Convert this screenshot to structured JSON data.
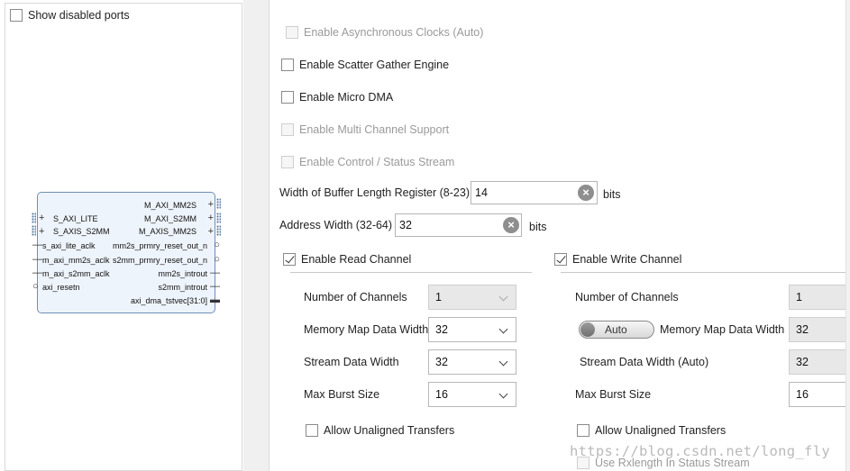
{
  "left": {
    "show_disabled_ports": "Show disabled ports",
    "ip": {
      "left_ports": [
        "S_AXI_LITE",
        "S_AXIS_S2MM",
        "s_axi_lite_aclk",
        "m_axi_mm2s_aclk",
        "m_axi_s2mm_aclk",
        "axi_resetn"
      ],
      "right_ports": [
        "M_AXI_MM2S",
        "M_AXI_S2MM",
        "M_AXIS_MM2S",
        "mm2s_prmry_reset_out_n",
        "s2mm_prmry_reset_out_n",
        "mm2s_introut",
        "s2mm_introut",
        "axi_dma_tstvec[31:0]"
      ]
    }
  },
  "options": {
    "async_clocks": "Enable Asynchronous Clocks (Auto)",
    "scatter_gather": "Enable Scatter Gather Engine",
    "micro_dma": "Enable Micro DMA",
    "multi_channel": "Enable Multi Channel Support",
    "control_status": "Enable Control / Status Stream"
  },
  "buffer_length": {
    "label": "Width of Buffer Length Register (8-23)",
    "value": "14",
    "unit": "bits"
  },
  "address_width": {
    "label": "Address Width (32-64)",
    "value": "32",
    "unit": "bits"
  },
  "read": {
    "enable_label": "Enable Read Channel",
    "num_channels_label": "Number of Channels",
    "num_channels": "1",
    "mm_width_label": "Memory Map Data Width",
    "mm_width": "32",
    "stream_width_label": "Stream Data Width",
    "stream_width": "32",
    "burst_label": "Max Burst Size",
    "burst": "16",
    "unaligned": "Allow Unaligned Transfers"
  },
  "write": {
    "enable_label": "Enable Write Channel",
    "num_channels_label": "Number of Channels",
    "num_channels": "1",
    "auto_toggle": "Auto",
    "mm_width_label": "Memory Map Data Width",
    "mm_width": "32",
    "stream_width_label": "Stream Data Width (Auto)",
    "stream_width": "32",
    "burst_label": "Max Burst Size",
    "burst": "16",
    "unaligned": "Allow Unaligned Transfers",
    "rxlength": "Use Rxlength In Status Stream"
  },
  "watermark": "https://blog.csdn.net/long_fly",
  "icons": {
    "clear": "clear-icon",
    "dropdown": "chevron-down-icon",
    "plus": "plus-icon",
    "bus": "bus-interface-icon"
  }
}
